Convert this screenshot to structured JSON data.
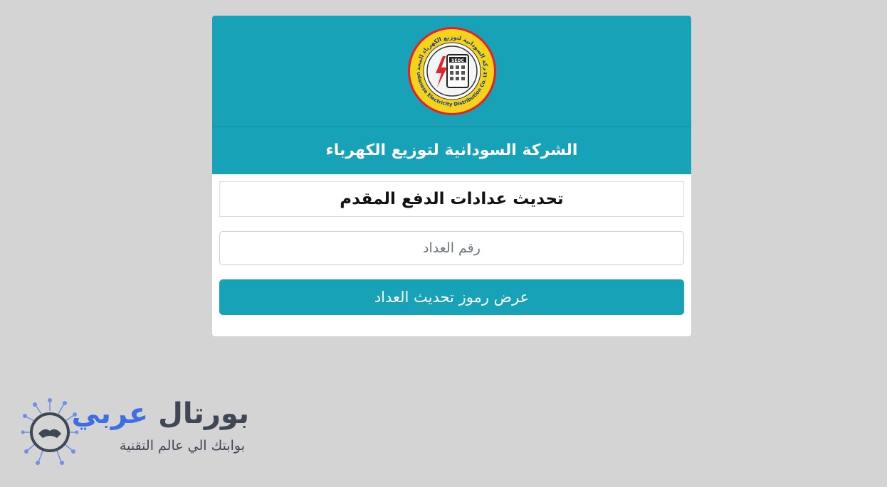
{
  "header": {
    "logo_arabic_text": "الشركة السودانية لتوزيع الكهرباء المحدودة",
    "logo_english_text": "Sudanese Electricity Distribution Co. Ltd",
    "logo_badge": "SEDC",
    "company_name": "الشركة السودانية لتوزيع الكهرباء"
  },
  "form": {
    "section_title": "تحديث عدادات الدفع المقدم",
    "meter_input": {
      "placeholder": "رقم العداد",
      "value": ""
    },
    "submit_label": "عرض رموز تحديث العداد"
  },
  "watermark": {
    "word_blue": "عربي",
    "word_dark": "بورتال",
    "tagline": "بوابتك الي عالم التقنية"
  },
  "colors": {
    "accent": "#18a2b8",
    "background": "#d4d4d4",
    "logo_yellow": "#f5d31a",
    "logo_red": "#e4202a"
  }
}
